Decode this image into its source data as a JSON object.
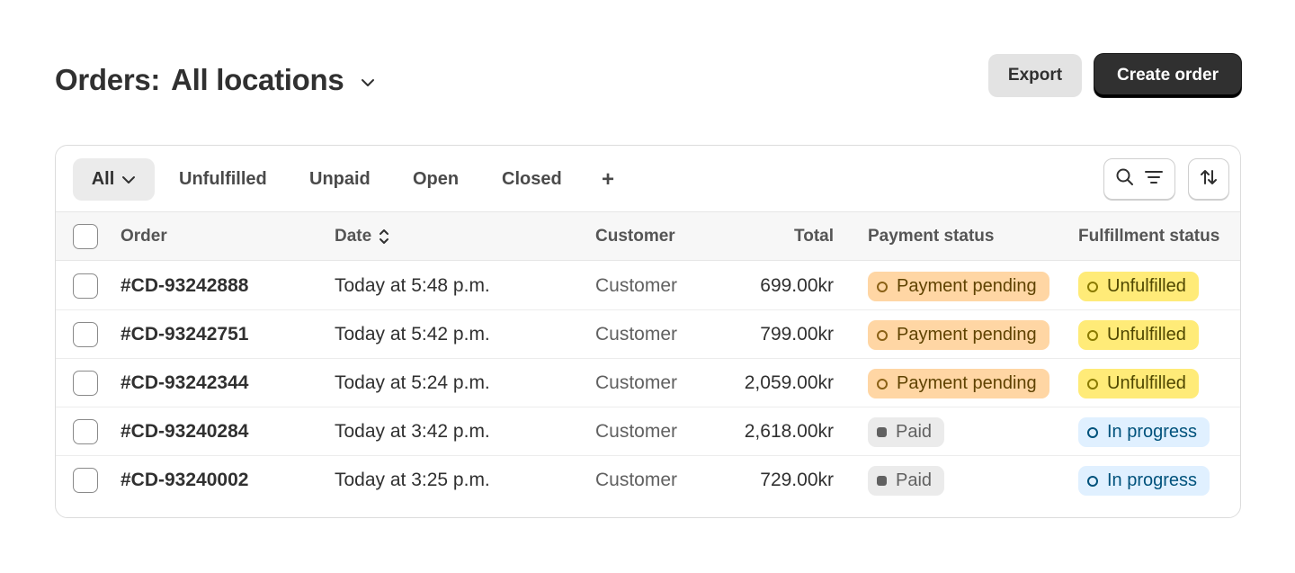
{
  "header": {
    "title_prefix": "Orders:",
    "title_location": "All locations",
    "export_label": "Export",
    "create_label": "Create order"
  },
  "tabs": [
    {
      "label": "All"
    },
    {
      "label": "Unfulfilled"
    },
    {
      "label": "Unpaid"
    },
    {
      "label": "Open"
    },
    {
      "label": "Closed"
    },
    {
      "label": "+"
    }
  ],
  "columns": {
    "order": "Order",
    "date": "Date",
    "customer": "Customer",
    "total": "Total",
    "payment": "Payment status",
    "fulfillment": "Fulfillment status"
  },
  "rows": [
    {
      "order": "#CD-93242888",
      "date": "Today at 5:48 p.m.",
      "customer": "Customer",
      "total": "699.00kr",
      "payment": "Payment pending",
      "fulfillment": "Unfulfilled"
    },
    {
      "order": "#CD-93242751",
      "date": "Today at 5:42 p.m.",
      "customer": "Customer",
      "total": "799.00kr",
      "payment": "Payment pending",
      "fulfillment": "Unfulfilled"
    },
    {
      "order": "#CD-93242344",
      "date": "Today at 5:24 p.m.",
      "customer": "Customer",
      "total": "2,059.00kr",
      "payment": "Payment pending",
      "fulfillment": "Unfulfilled"
    },
    {
      "order": "#CD-93240284",
      "date": "Today at 3:42 p.m.",
      "customer": "Customer",
      "total": "2,618.00kr",
      "payment": "Paid",
      "fulfillment": "In progress"
    },
    {
      "order": "#CD-93240002",
      "date": "Today at 3:25 p.m.",
      "customer": "Customer",
      "total": "729.00kr",
      "payment": "Paid",
      "fulfillment": "In progress"
    }
  ],
  "colors": {
    "pending_bg": "#ffd6a4",
    "unfulfilled_bg": "#ffeb78",
    "paid_bg": "#ebebeb",
    "in_progress_bg": "#e0f0ff",
    "primary_button": "#303030"
  },
  "icons": [
    "chevron-down-icon",
    "sort-icon",
    "search-icon",
    "filter-icon",
    "sort-arrows-icon"
  ]
}
